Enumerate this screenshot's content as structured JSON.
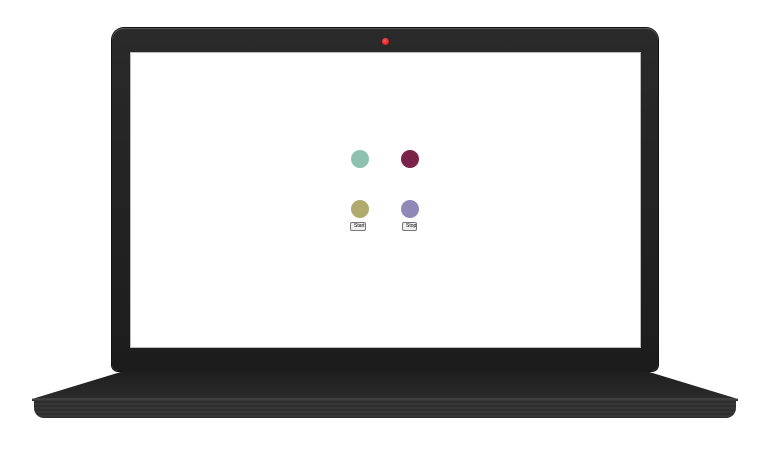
{
  "screen": {
    "dots": [
      {
        "name": "top-left-dot",
        "color": "#8fc1b1"
      },
      {
        "name": "top-right-dot",
        "color": "#7a2449"
      },
      {
        "name": "bottom-left-dot",
        "color": "#b0aa6e"
      },
      {
        "name": "bottom-right-dot",
        "color": "#9089b8"
      }
    ],
    "start_label": "Start",
    "stop_label": "Stop"
  },
  "device": {
    "webcam_color": "#e00000",
    "bezel_color": "#222222"
  }
}
